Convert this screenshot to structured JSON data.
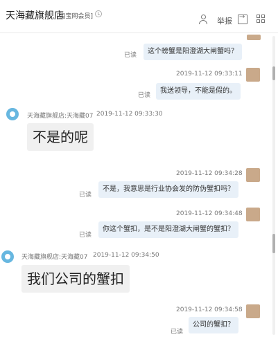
{
  "header": {
    "shop_name": "天海藏旗舰店",
    "member_tag": "[淘宝网会员]",
    "report_label": "举报"
  },
  "messages": [
    {
      "side": "right",
      "read": "已读",
      "text": "这个螃蟹是阳澄湖大闸蟹吗？"
    },
    {
      "side": "right",
      "timestamp": "2019-11-12 09:33:11",
      "read": "已读",
      "text": "我送领导，不能是假的。"
    },
    {
      "side": "left",
      "sender": "天海藏旗舰店:天海藏07",
      "timestamp": "2019-11-12 09:33:30",
      "text": "不是的呢"
    },
    {
      "side": "right",
      "timestamp": "2019-11-12 09:34:28",
      "read": "已读",
      "text": "不是，我意思是行业协会发的防伪蟹扣吗？"
    },
    {
      "side": "right",
      "timestamp": "2019-11-12 09:34:48",
      "read": "已读",
      "text": "你这个蟹扣，是不是阳澄湖大闸蟹的蟹扣？"
    },
    {
      "side": "left",
      "sender": "天海藏旗舰店:天海藏07",
      "timestamp": "2019-11-12 09:34:50",
      "text": "我们公司的蟹扣"
    },
    {
      "side": "right",
      "timestamp": "2019-11-12 09:34:58",
      "read": "已读",
      "text": "公司的蟹扣？"
    }
  ],
  "colors": {
    "buyer_bubble": "#e8f0f8",
    "seller_bubble": "#f0f0f0",
    "seller_avatar": "#67b7e0"
  }
}
